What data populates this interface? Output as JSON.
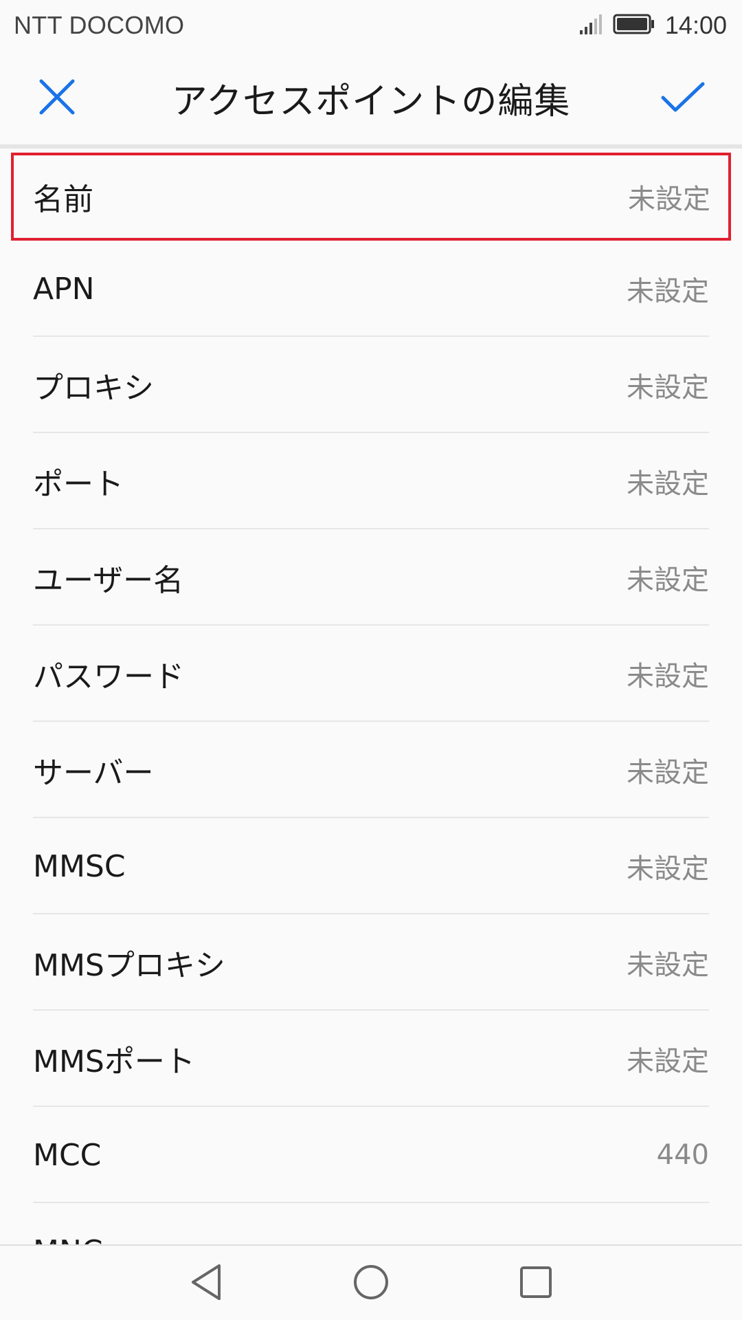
{
  "status_bar": {
    "carrier": "NTT DOCOMO",
    "time": "14:00"
  },
  "header": {
    "title": "アクセスポイントの編集"
  },
  "items": [
    {
      "label": "名前",
      "value": "未設定"
    },
    {
      "label": "APN",
      "value": "未設定"
    },
    {
      "label": "プロキシ",
      "value": "未設定"
    },
    {
      "label": "ポート",
      "value": "未設定"
    },
    {
      "label": "ユーザー名",
      "value": "未設定"
    },
    {
      "label": "パスワード",
      "value": "未設定"
    },
    {
      "label": "サーバー",
      "value": "未設定"
    },
    {
      "label": "MMSC",
      "value": "未設定"
    },
    {
      "label": "MMSプロキシ",
      "value": "未設定"
    },
    {
      "label": "MMSポート",
      "value": "未設定"
    },
    {
      "label": "MCC",
      "value": "440"
    },
    {
      "label": "MNC",
      "value": ""
    }
  ],
  "colors": {
    "accent": "#1a73e8",
    "highlight": "#e02030"
  },
  "icons": {
    "close": "close-icon",
    "confirm": "check-icon",
    "back": "back-triangle-icon",
    "home": "home-circle-icon",
    "recents": "recents-square-icon"
  }
}
